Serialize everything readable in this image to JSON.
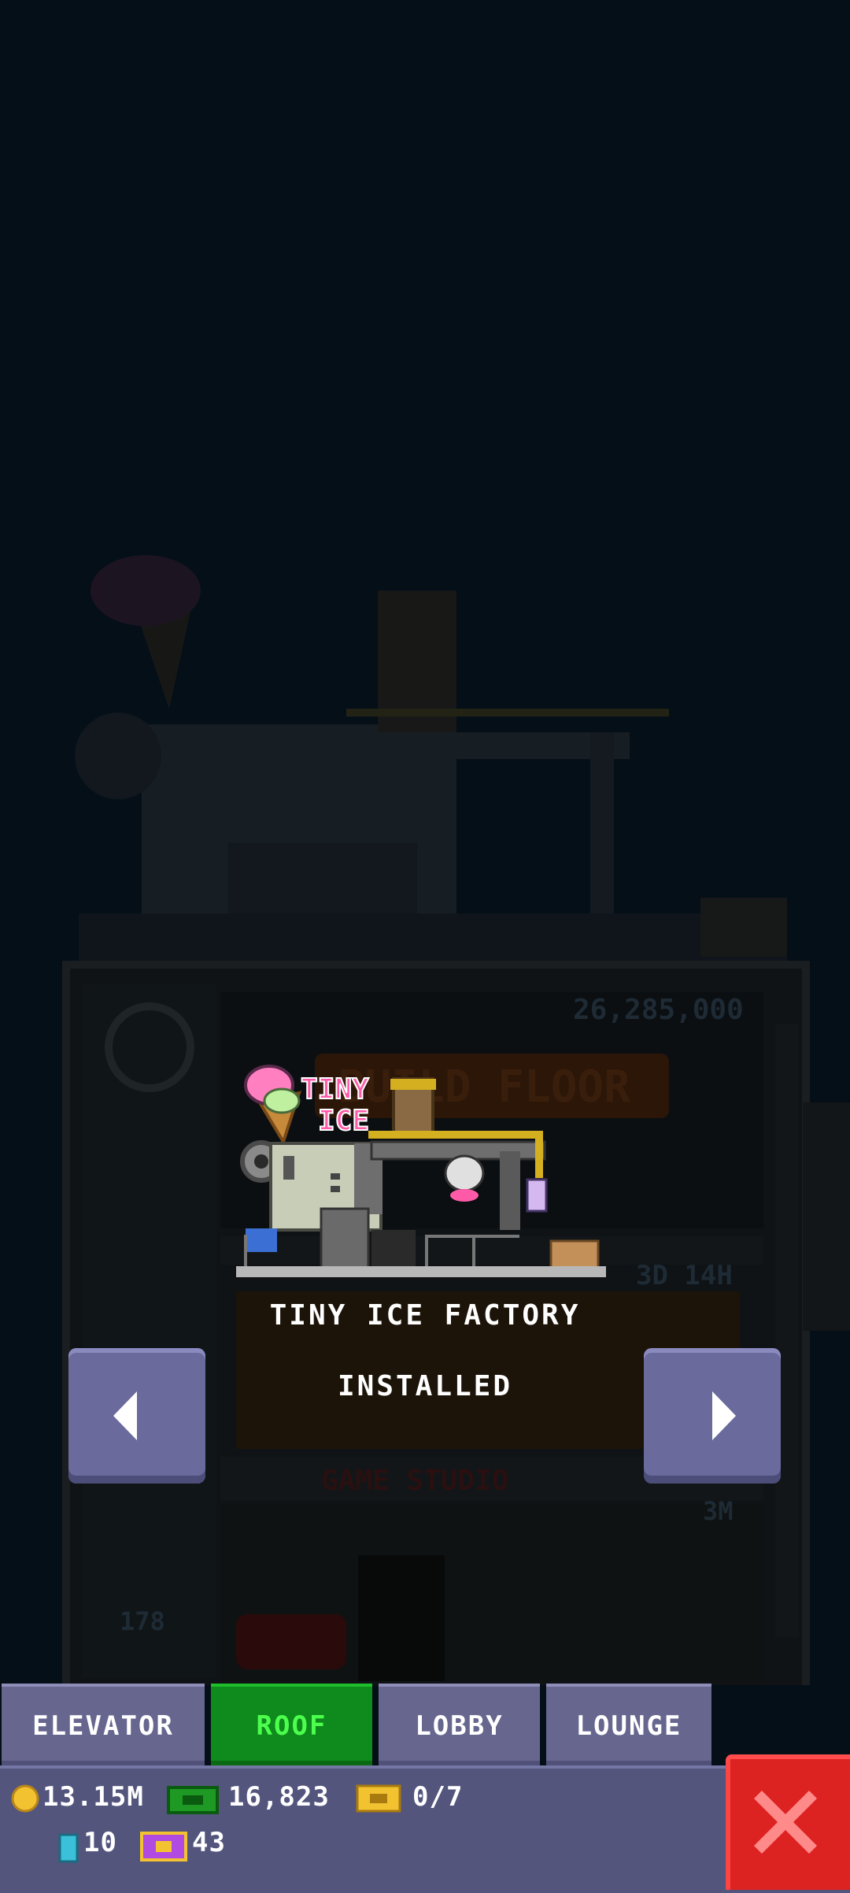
{
  "background": {
    "tower_price": "26,285,000",
    "build_floor_label": "BUILD FLOOR",
    "timer": "3D 14H",
    "floor_name": "GAME STUDIO",
    "floor_price": "3M",
    "floor_number": "178"
  },
  "preview": {
    "roof_name": "TINY ICE FACTORY",
    "status": "INSTALLED",
    "sign_text_1": "TINY",
    "sign_text_2": "ICE"
  },
  "navigation": {
    "prev_icon": "left-arrow-icon",
    "next_icon": "right-arrow-icon"
  },
  "tabs": [
    {
      "label": "ELEVATOR",
      "active": false
    },
    {
      "label": "ROOF",
      "active": true
    },
    {
      "label": "LOBBY",
      "active": false
    },
    {
      "label": "LOUNGE",
      "active": false
    }
  ],
  "status_bar": {
    "coins": "13.15M",
    "bux": "16,823",
    "vip_tickets": "0/7",
    "keys": "10",
    "golden_tickets": "43"
  },
  "colors": {
    "accent_active_tab": "#0f8a1c",
    "tab": "#66668f",
    "close": "#dd2222",
    "status_bar": "#53557d"
  }
}
